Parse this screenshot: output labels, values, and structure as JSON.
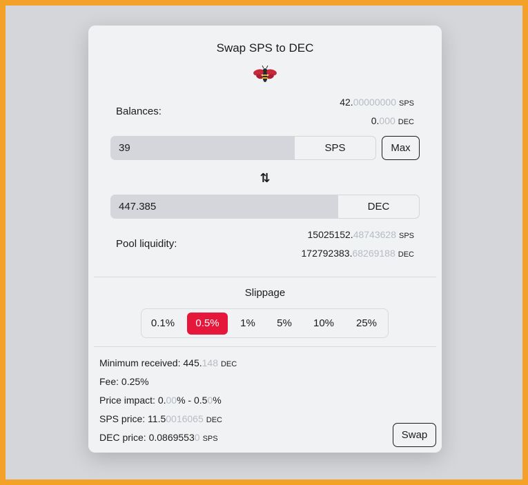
{
  "title": "Swap SPS to DEC",
  "logo_icon": "bee-icon",
  "balances": {
    "label": "Balances:",
    "sps": {
      "main": "42.",
      "dim": "00000000",
      "unit": "SPS"
    },
    "dec": {
      "main": "0.",
      "dim": "000",
      "unit": "DEC"
    }
  },
  "from": {
    "value": "39",
    "unit": "SPS",
    "max_label": "Max"
  },
  "swap_direction_icon": "swap-arrows-icon",
  "to": {
    "value": "447.385",
    "unit": "DEC"
  },
  "pool": {
    "label": "Pool liquidity:",
    "sps": {
      "main": "15025152.",
      "dim": "48743628",
      "unit": "SPS"
    },
    "dec": {
      "main": "172792383.",
      "dim": "68269188",
      "unit": "DEC"
    }
  },
  "slippage": {
    "title": "Slippage",
    "options": [
      "0.1%",
      "0.5%",
      "1%",
      "5%",
      "10%",
      "25%"
    ],
    "selected": "0.5%"
  },
  "details": {
    "min_received": {
      "label": "Minimum received: ",
      "main": "445.",
      "dim": "148",
      "unit": "DEC"
    },
    "fee": {
      "text": "Fee: 0.25%"
    },
    "price_impact": {
      "label": "Price impact: ",
      "a_main": "0.",
      "a_dim": "00",
      "mid": "% - 0.5",
      "b_dim": "0",
      "end": "%"
    },
    "sps_price": {
      "label": "SPS price: ",
      "main": "11.5",
      "dim": "0016065",
      "unit": "DEC"
    },
    "dec_price": {
      "label": "DEC price: ",
      "main": "0.0869553",
      "dim": "0",
      "unit": "SPS"
    }
  },
  "swap_label": "Swap",
  "colors": {
    "accent": "#e5183c",
    "frame": "#f4a12a"
  }
}
